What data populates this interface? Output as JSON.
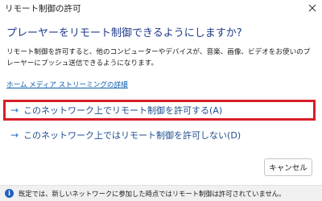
{
  "window": {
    "title": "リモート制御の許可",
    "close_icon": "close-icon"
  },
  "main": {
    "heading": "プレーヤーをリモート制御できるようにしますか?",
    "description": "リモート制御を許可すると、他のコンピューターやデバイスが、音楽、画像、ビデオをお使いのプレーヤーにプッシュ送信できるようになります。",
    "details_link": "ホーム メディア ストリーミングの詳細"
  },
  "commands": {
    "allow_label": "このネットワーク上でリモート制御を許可する(A)",
    "deny_label": "このネットワーク上ではリモート制御を許可しない(D)",
    "arrow_icon": "arrow-right-icon"
  },
  "footer": {
    "cancel_label": "キャンセル"
  },
  "infobar": {
    "icon": "info-icon",
    "text": "既定では、新しいネットワークに参加した時点ではリモート制御は許可されていません。"
  },
  "colors": {
    "heading": "#1e3a8a",
    "link": "#0b5cad",
    "highlight_border": "#d81e28"
  }
}
